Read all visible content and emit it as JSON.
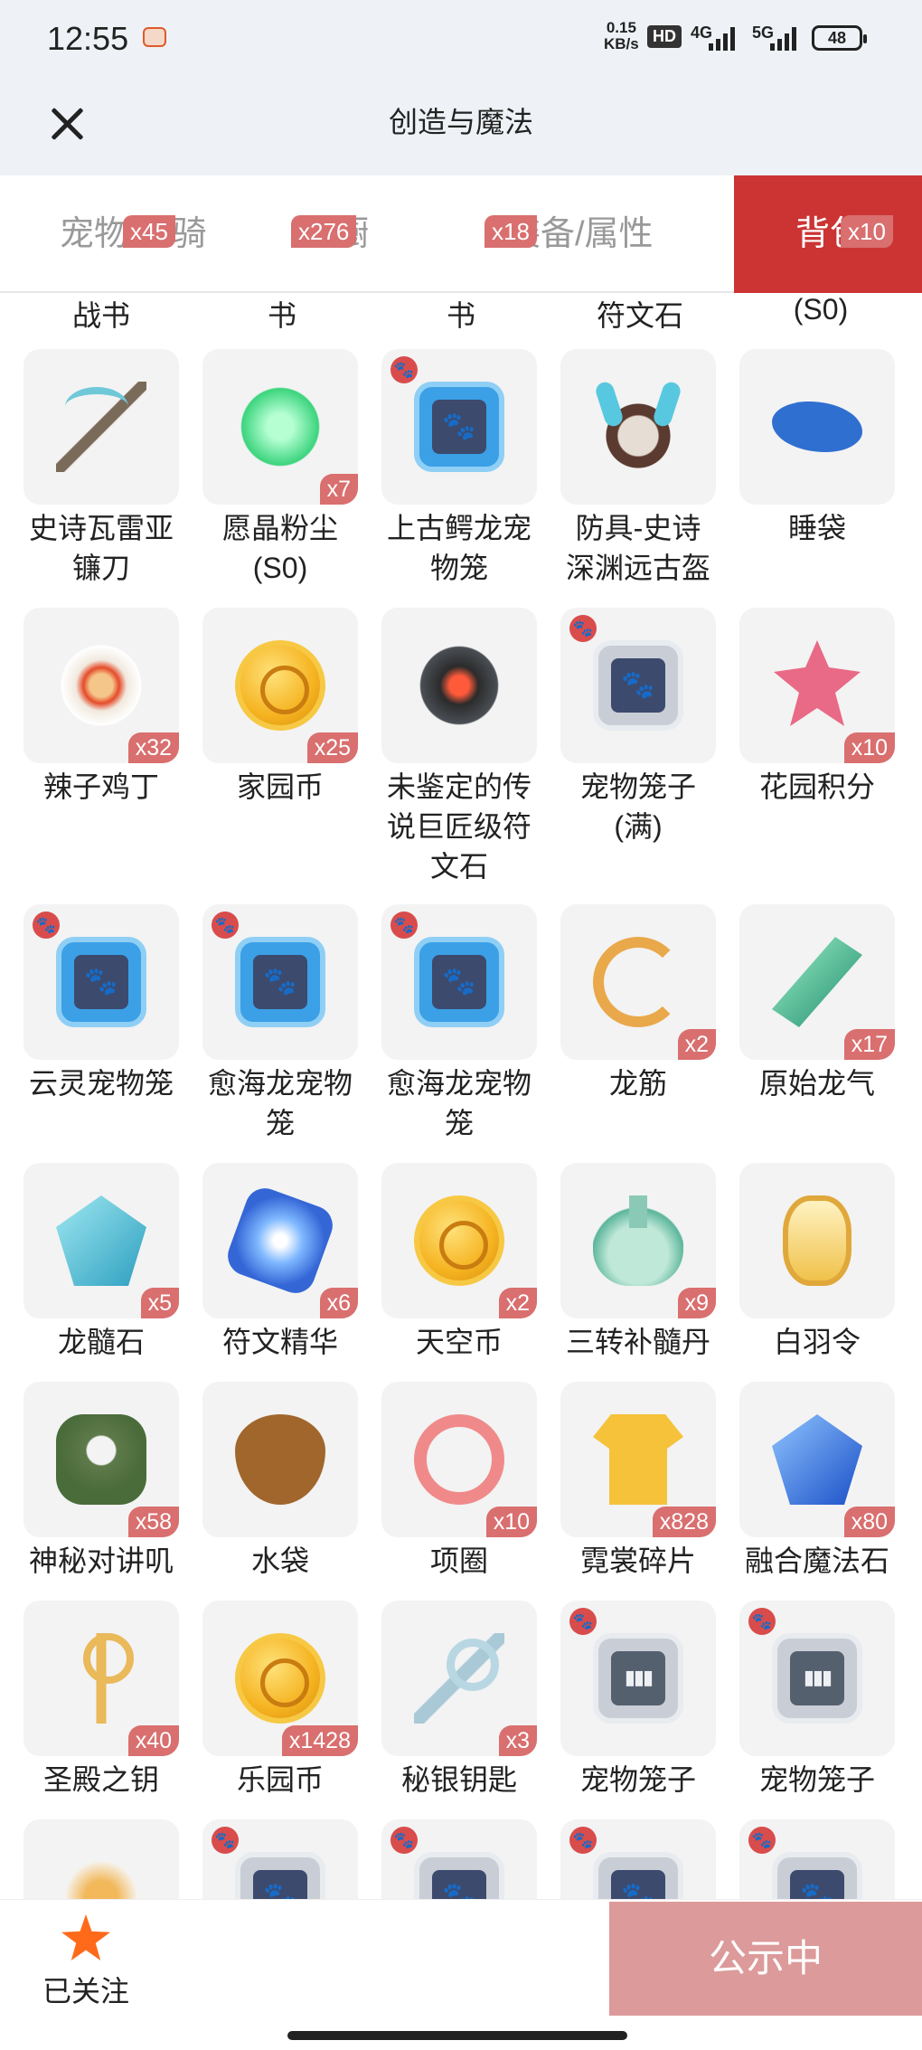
{
  "status_bar": {
    "time": "12:55",
    "net_speed": "0.15",
    "net_unit": "KB/s",
    "hd": "HD",
    "sig1": "4G",
    "sig2": "5G",
    "battery": "48"
  },
  "header": {
    "title": "创造与魔法"
  },
  "tabs": [
    {
      "label": "宠物/坐骑",
      "badge": "x45"
    },
    {
      "label": "衣橱",
      "badge": "x276"
    },
    {
      "label": "装备/属性",
      "badge": "x18"
    },
    {
      "label": "背包",
      "badge": "x10"
    }
  ],
  "top_row_labels": [
    "战书",
    "书",
    "书",
    "符文石",
    "(S0)"
  ],
  "items": [
    {
      "name": "史诗瓦雷亚\n镰刀",
      "icon": "scythe-icon",
      "badge": ""
    },
    {
      "name": "愿晶粉尘\n(S0)",
      "icon": "dust-icon",
      "badge": "x7"
    },
    {
      "name": "上古鳄龙宠\n物笼",
      "icon": "pet-cage-icon",
      "badge": "",
      "paw": true
    },
    {
      "name": "防具-史诗\n深渊远古盔",
      "icon": "helmet-icon",
      "badge": ""
    },
    {
      "name": "睡袋",
      "icon": "sleeping-bag-icon",
      "badge": ""
    },
    {
      "name": "辣子鸡丁",
      "icon": "dish-icon",
      "badge": "x32"
    },
    {
      "name": "家园币",
      "icon": "coin-icon",
      "badge": "x25"
    },
    {
      "name": "未鉴定的传\n说巨匠级符\n文石",
      "icon": "rune-stone-icon",
      "badge": ""
    },
    {
      "name": "宠物笼子\n(满)",
      "icon": "pet-cage-grey-icon",
      "badge": "",
      "paw": true
    },
    {
      "name": "花园积分",
      "icon": "flower-icon",
      "badge": "x10"
    },
    {
      "name": "云灵宠物笼",
      "icon": "pet-cage-icon",
      "badge": "",
      "paw": true
    },
    {
      "name": "愈海龙宠物\n笼",
      "icon": "pet-cage-icon",
      "badge": "",
      "paw": true
    },
    {
      "name": "愈海龙宠物\n笼",
      "icon": "pet-cage-icon",
      "badge": "",
      "paw": true
    },
    {
      "name": "龙筋",
      "icon": "sinew-icon",
      "badge": "x2"
    },
    {
      "name": "原始龙气",
      "icon": "green-crystal-icon",
      "badge": "x17"
    },
    {
      "name": "龙髓石",
      "icon": "crystal-icon",
      "badge": "x5"
    },
    {
      "name": "符文精华",
      "icon": "orb-icon",
      "badge": "x6"
    },
    {
      "name": "天空币",
      "icon": "coin-icon",
      "badge": "x2"
    },
    {
      "name": "三转补髓丹",
      "icon": "potion-icon",
      "badge": "x9"
    },
    {
      "name": "白羽令",
      "icon": "token-icon",
      "badge": ""
    },
    {
      "name": "神秘对讲叽",
      "icon": "robot-icon",
      "badge": "x58"
    },
    {
      "name": "水袋",
      "icon": "pouch-icon",
      "badge": ""
    },
    {
      "name": "项圈",
      "icon": "collar-icon",
      "badge": "x10"
    },
    {
      "name": "霓裳碎片",
      "icon": "shirt-icon",
      "badge": "x828"
    },
    {
      "name": "融合魔法石",
      "icon": "blue-crystal-icon",
      "badge": "x80"
    },
    {
      "name": "圣殿之钥",
      "icon": "gold-key-icon",
      "badge": "x40"
    },
    {
      "name": "乐园币",
      "icon": "coin-icon",
      "badge": "x1428"
    },
    {
      "name": "秘银钥匙",
      "icon": "silver-key-icon",
      "badge": "x3"
    },
    {
      "name": "宠物笼子",
      "icon": "barred-cage-icon",
      "badge": "",
      "paw": true
    },
    {
      "name": "宠物笼子",
      "icon": "barred-cage-icon",
      "badge": "",
      "paw": true
    },
    {
      "name": "",
      "icon": "noodle-bowl-icon",
      "badge": ""
    },
    {
      "name": "",
      "icon": "pet-cage-grey-icon",
      "badge": "",
      "paw": true
    },
    {
      "name": "",
      "icon": "pet-cage-grey-icon",
      "badge": "",
      "paw": true
    },
    {
      "name": "",
      "icon": "pet-cage-grey-icon",
      "badge": "",
      "paw": true
    },
    {
      "name": "",
      "icon": "pet-cage-grey-icon",
      "badge": "",
      "paw": true
    }
  ],
  "bottom": {
    "follow_label": "已关注",
    "public_label": "公示中"
  }
}
